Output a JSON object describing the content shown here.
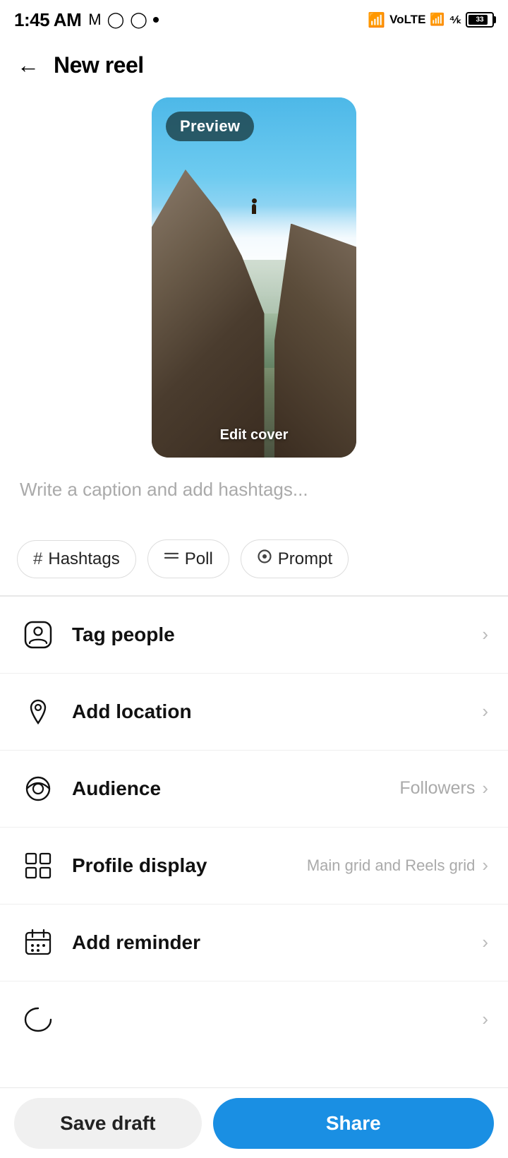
{
  "statusBar": {
    "time": "1:45 AM",
    "icons": [
      "M",
      "📷",
      "📸",
      "•"
    ],
    "battery": "33"
  },
  "header": {
    "title": "New reel",
    "backLabel": "←"
  },
  "preview": {
    "previewBadge": "Preview",
    "editCoverLabel": "Edit cover"
  },
  "caption": {
    "placeholder": "Write a caption and add hashtags..."
  },
  "tagButtons": [
    {
      "id": "hashtags",
      "icon": "#",
      "label": "Hashtags"
    },
    {
      "id": "poll",
      "icon": "≡",
      "label": "Poll"
    },
    {
      "id": "prompt",
      "icon": "◯",
      "label": "Prompt"
    }
  ],
  "menuItems": [
    {
      "id": "tag-people",
      "label": "Tag people",
      "value": "",
      "icon": "person"
    },
    {
      "id": "add-location",
      "label": "Add location",
      "value": "",
      "icon": "location"
    },
    {
      "id": "audience",
      "label": "Audience",
      "value": "Followers",
      "icon": "audience"
    },
    {
      "id": "profile-display",
      "label": "Profile display",
      "value": "Main grid and Reels grid",
      "icon": "grid"
    },
    {
      "id": "add-reminder",
      "label": "Add reminder",
      "value": "",
      "icon": "calendar"
    }
  ],
  "bottomBar": {
    "saveDraftLabel": "Save draft",
    "shareLabel": "Share"
  }
}
